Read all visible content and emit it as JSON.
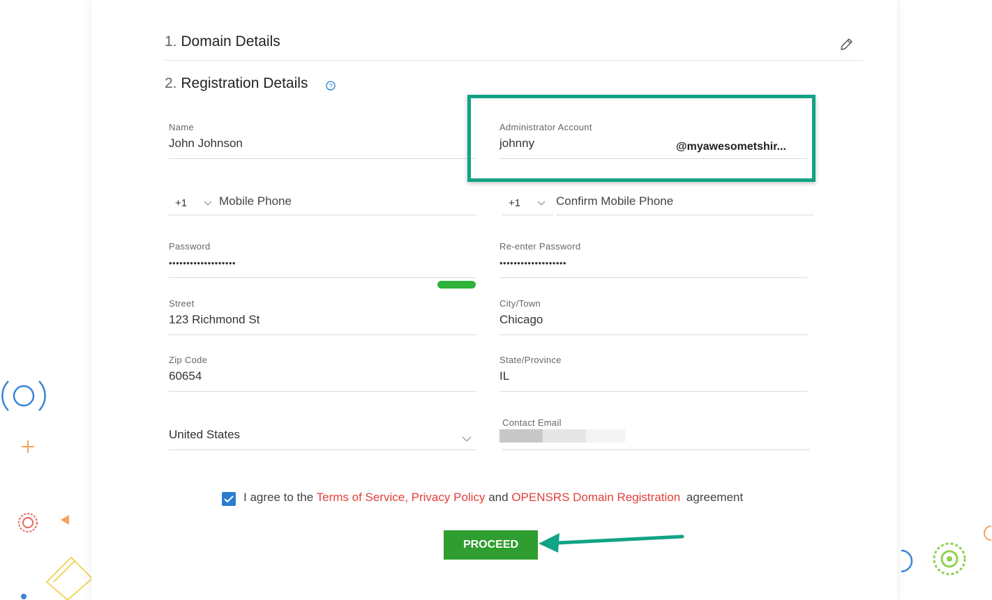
{
  "sections": {
    "domain_details": {
      "number": "1.",
      "title": "Domain Details"
    },
    "registration_details": {
      "number": "2.",
      "title": "Registration Details"
    }
  },
  "fields": {
    "name": {
      "label": "Name",
      "value": "John Johnson"
    },
    "admin_account": {
      "label": "Administrator Account",
      "value": "johnny",
      "domain_suffix": "@myawesometshir..."
    },
    "mobile_phone": {
      "code": "+1",
      "placeholder": "Mobile Phone"
    },
    "confirm_mobile_phone": {
      "code": "+1",
      "placeholder": "Confirm Mobile Phone"
    },
    "password": {
      "label": "Password",
      "value": "•••••••••••••••••••"
    },
    "reenter_password": {
      "label": "Re-enter Password",
      "value": "•••••••••••••••••••"
    },
    "street": {
      "label": "Street",
      "value": "123 Richmond St"
    },
    "city": {
      "label": "City/Town",
      "value": "Chicago"
    },
    "zip": {
      "label": "Zip Code",
      "value": "60654"
    },
    "state": {
      "label": "State/Province",
      "value": "IL"
    },
    "country": {
      "value": "United States"
    },
    "contact_email": {
      "label": "Contact Email"
    }
  },
  "agreement": {
    "prefix": "I agree to the",
    "terms": "Terms of Service,",
    "privacy": "Privacy Policy",
    "and": "and",
    "opensrs": "OPENSRS Domain Registration",
    "suffix": "agreement",
    "checked": true
  },
  "buttons": {
    "proceed": "PROCEED"
  },
  "icons": {
    "edit": "pencil-icon",
    "help": "question-circle-icon",
    "dropdown": "chevron-down-icon",
    "checkbox": "checkmark-icon"
  },
  "colors": {
    "accent_green": "#2f9d2f",
    "highlight": "#12a386",
    "link_red": "#e0403a",
    "checkbox_blue": "#2a7dd0",
    "strength_bar": "#2db13a"
  }
}
